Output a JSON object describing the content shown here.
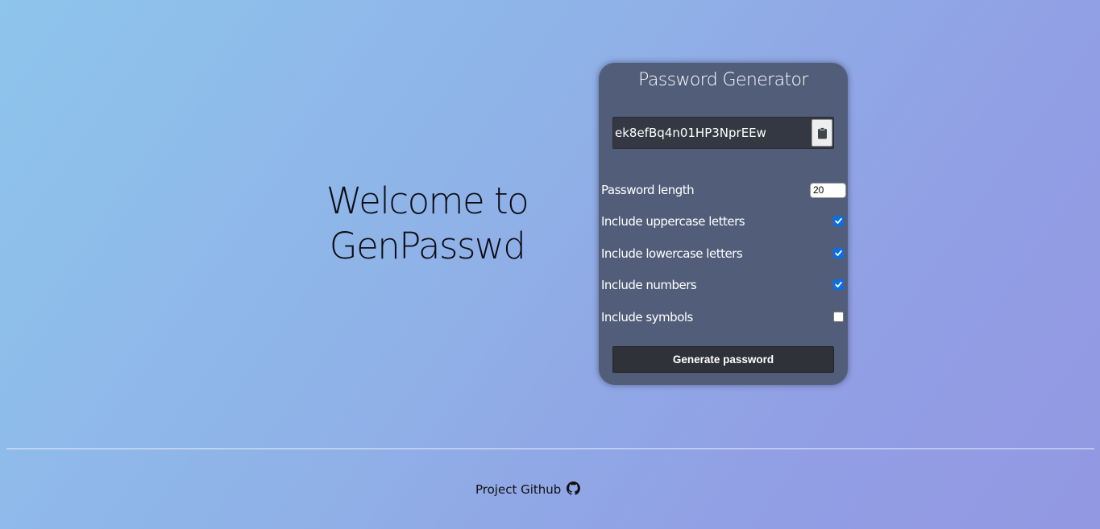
{
  "hero": {
    "line1": "Welcome to",
    "line2": "GenPasswd"
  },
  "generator": {
    "title": "Password Generator",
    "password": "ek8efBq4n01HP3NprEEw",
    "copy_icon": "clipboard-icon",
    "length_label": "Password length",
    "length_value": "20",
    "options": [
      {
        "label": "Include uppercase letters",
        "checked": true
      },
      {
        "label": "Include lowercase letters",
        "checked": true
      },
      {
        "label": "Include numbers",
        "checked": true
      },
      {
        "label": "Include symbols",
        "checked": false
      }
    ],
    "generate_label": "Generate password"
  },
  "footer": {
    "link_text": "Project Github",
    "icon": "github-icon"
  },
  "colors": {
    "card_bg": "#525e79",
    "checkbox_accent": "#0b6fe0",
    "button_bg": "#30323a"
  }
}
